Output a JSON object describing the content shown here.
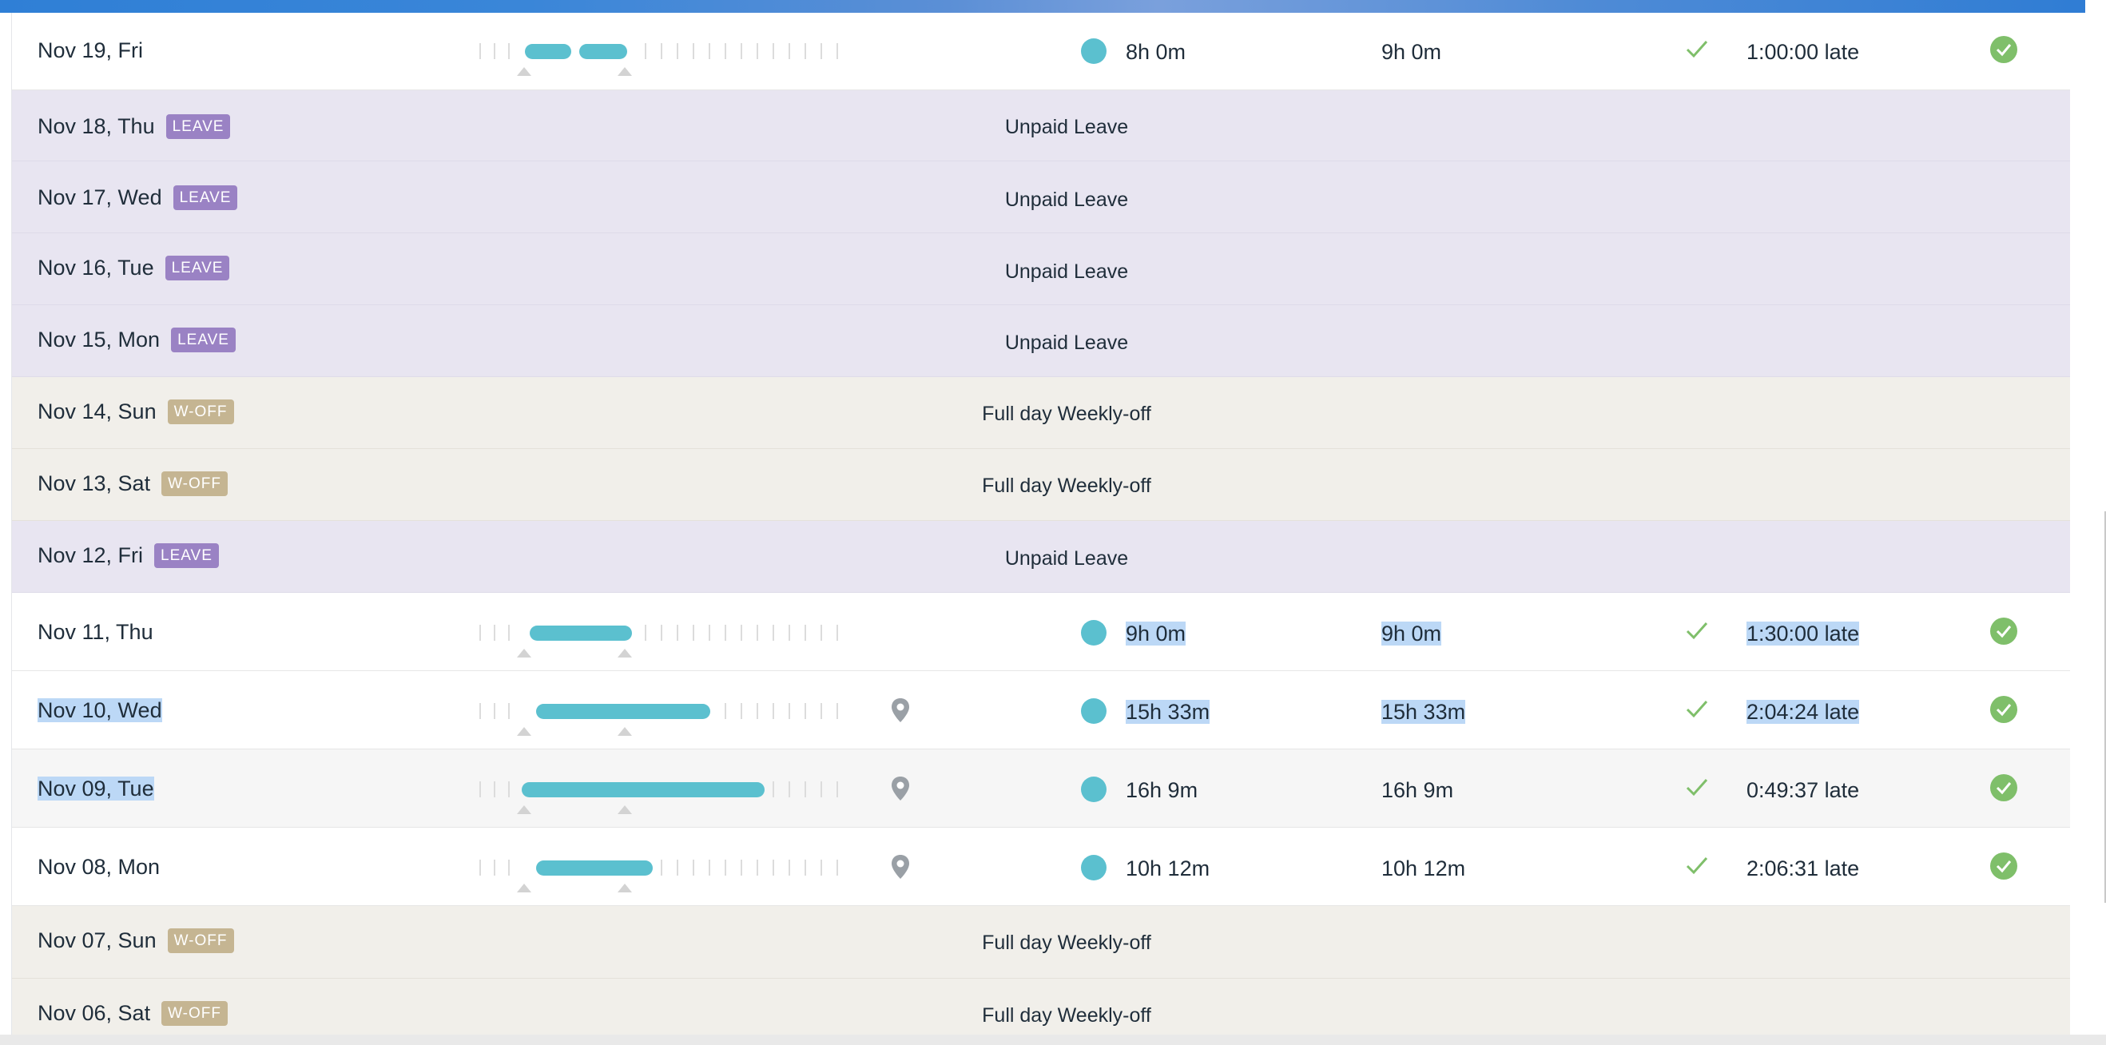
{
  "rows": [
    {
      "date": "Nov 19, Fri",
      "type": "work",
      "effective": "8h 0m",
      "gross": "9h 0m",
      "late": "1:00:00 late",
      "pin": false
    },
    {
      "date": "Nov 18, Thu",
      "type": "leave",
      "badge": "LEAVE",
      "label": "Unpaid Leave"
    },
    {
      "date": "Nov 17, Wed",
      "type": "leave",
      "badge": "LEAVE",
      "label": "Unpaid Leave"
    },
    {
      "date": "Nov 16, Tue",
      "type": "leave",
      "badge": "LEAVE",
      "label": "Unpaid Leave"
    },
    {
      "date": "Nov 15, Mon",
      "type": "leave",
      "badge": "LEAVE",
      "label": "Unpaid Leave"
    },
    {
      "date": "Nov 14, Sun",
      "type": "woff",
      "badge": "W-OFF",
      "label": "Full day Weekly-off"
    },
    {
      "date": "Nov 13, Sat",
      "type": "woff",
      "badge": "W-OFF",
      "label": "Full day Weekly-off"
    },
    {
      "date": "Nov 12, Fri",
      "type": "leave",
      "badge": "LEAVE",
      "label": "Unpaid Leave"
    },
    {
      "date": "Nov 11, Thu",
      "type": "work",
      "effective": "9h 0m",
      "gross": "9h 0m",
      "late": "1:30:00 late",
      "pin": false
    },
    {
      "date": "Nov 10, Wed",
      "type": "work",
      "effective": "15h 33m",
      "gross": "15h 33m",
      "late": "2:04:24 late",
      "pin": true
    },
    {
      "date": "Nov 09, Tue",
      "type": "work",
      "effective": "16h 9m",
      "gross": "16h 9m",
      "late": "0:49:37 late",
      "pin": true
    },
    {
      "date": "Nov 08, Mon",
      "type": "work",
      "effective": "10h 12m",
      "gross": "10h 12m",
      "late": "2:06:31 late",
      "pin": true
    },
    {
      "date": "Nov 07, Sun",
      "type": "woff",
      "badge": "W-OFF",
      "label": "Full day Weekly-off"
    },
    {
      "date": "Nov 06, Sat",
      "type": "woff",
      "badge": "W-OFF",
      "label": "Full day Weekly-off"
    }
  ],
  "colors": {
    "accent_teal": "#5bc0cf",
    "leave_badge": "#9a82c4",
    "woff_badge": "#c5b592",
    "leave_row": "#e8e5f1",
    "woff_row": "#f1efea",
    "success_green": "#7fbf6a",
    "selection": "#bcd8f6"
  },
  "icons": {
    "location": "location-pin-icon",
    "status_dot": "status-dot-icon",
    "approved_check": "checkmark-icon",
    "approved_badge": "approved-circle-icon"
  }
}
